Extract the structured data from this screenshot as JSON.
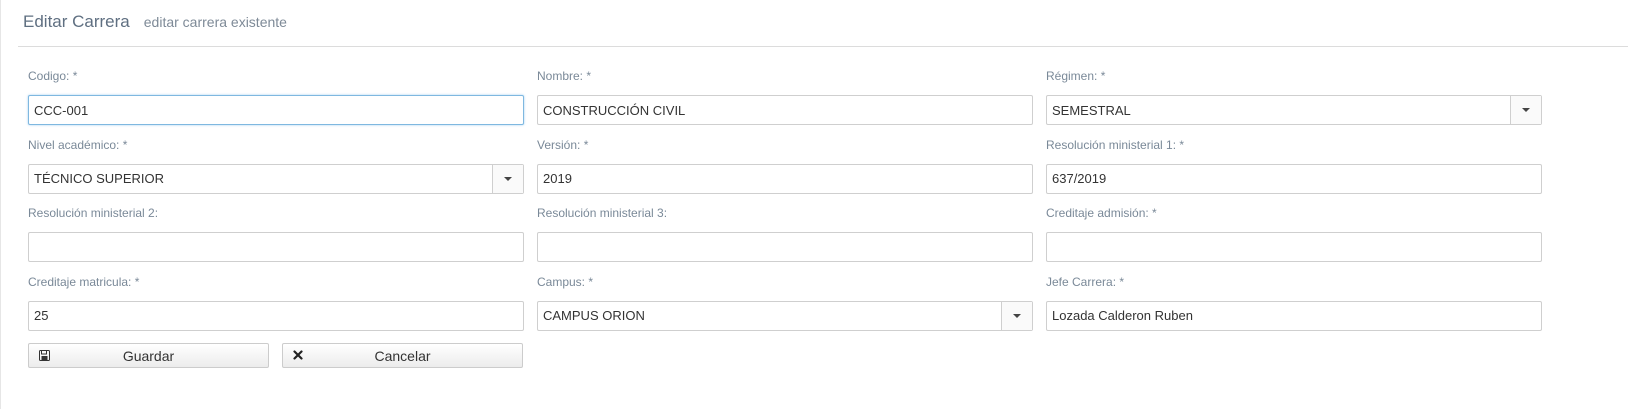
{
  "header": {
    "title": "Editar Carrera",
    "subtitle": "editar carrera existente"
  },
  "form": {
    "codigo": {
      "label": "Codigo: *",
      "value": "CCC-001"
    },
    "nombre": {
      "label": "Nombre: *",
      "value": "CONSTRUCCIÓN CIVIL"
    },
    "regimen": {
      "label": "Régimen: *",
      "value": "SEMESTRAL"
    },
    "nivel_academico": {
      "label": "Nivel académico: *",
      "value": "TÉCNICO SUPERIOR"
    },
    "version": {
      "label": "Versión: *",
      "value": "2019"
    },
    "resolucion_1": {
      "label": "Resolución ministerial 1: *",
      "value": "637/2019"
    },
    "resolucion_2": {
      "label": "Resolución ministerial 2:",
      "value": ""
    },
    "resolucion_3": {
      "label": "Resolución ministerial 3:",
      "value": ""
    },
    "creditaje_admision": {
      "label": "Creditaje admisión: *",
      "value": ""
    },
    "creditaje_matricula": {
      "label": "Creditaje matricula: *",
      "value": "25"
    },
    "campus": {
      "label": "Campus: *",
      "value": "CAMPUS ORION"
    },
    "jefe_carrera": {
      "label": "Jefe Carrera: *",
      "value": "Lozada Calderon Ruben"
    }
  },
  "buttons": {
    "save_label": "Guardar",
    "cancel_label": "Cancelar",
    "save_icon": "floppy-disk-icon",
    "cancel_icon": "close-icon"
  },
  "colors": {
    "focus_border": "#7fb8e0",
    "title": "#5f6f81",
    "label": "#7a8998"
  }
}
